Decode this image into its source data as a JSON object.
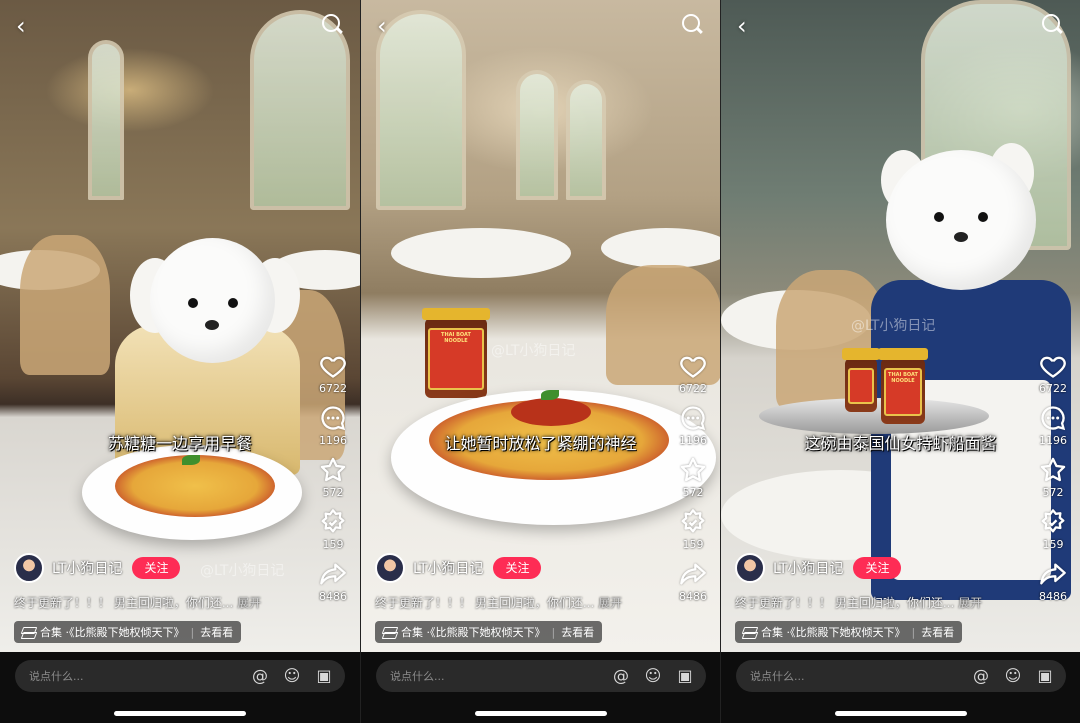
{
  "panels": [
    {
      "caption": "苏糖糖一边享用早餐",
      "like_count": "6722",
      "comment_count": "1196",
      "favorite_count": "572",
      "share_count_label": "159",
      "forward_count": "8486",
      "author": "LT小狗日记",
      "follow_label": "关注",
      "description": "终于更新了！！！ 男主回归啦，你们还...",
      "more_label": "展开",
      "collection_label": "合集 ·《比熊殿下她权倾天下》",
      "collection_action": "去看看",
      "comment_placeholder": "说点什么...",
      "watermark": "@LT小狗日记"
    },
    {
      "caption": "让她暂时放松了紧绷的神经",
      "like_count": "6722",
      "comment_count": "1196",
      "favorite_count": "572",
      "share_count_label": "159",
      "forward_count": "8486",
      "author": "LT小狗日记",
      "follow_label": "关注",
      "description": "终于更新了！！！ 男主回归啦，你们还...",
      "more_label": "展开",
      "collection_label": "合集 ·《比熊殿下她权倾天下》",
      "collection_action": "去看看",
      "comment_placeholder": "说点什么...",
      "watermark": "@LT小狗日记",
      "jar_label": "THAI BOAT NOODLE"
    },
    {
      "caption": "这碗由泰国仙女持虾船面酱",
      "like_count": "6722",
      "comment_count": "1196",
      "favorite_count": "572",
      "share_count_label": "159",
      "forward_count": "8486",
      "author": "LT小狗日记",
      "follow_label": "关注",
      "description": "终于更新了！！！ 男主回归啦，你们还...",
      "more_label": "展开",
      "collection_label": "合集 ·《比熊殿下她权倾天下》",
      "collection_action": "去看看",
      "comment_placeholder": "说点什么...",
      "watermark": "@LT小狗日记",
      "jar_label": "THAI BOAT NOODLE"
    }
  ],
  "icons": [
    "back-icon",
    "search-icon",
    "heart-icon",
    "comment-icon",
    "star-icon",
    "share-icon",
    "forward-icon",
    "at-icon",
    "emoji-icon",
    "image-icon",
    "layers-icon"
  ],
  "colors": {
    "follow_button": "#fe2c55",
    "bottom_bar": "#0d0d0d",
    "comment_box": "#2a2a2a"
  }
}
